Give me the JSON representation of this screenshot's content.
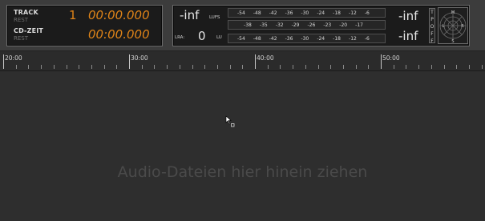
{
  "counter_panel": {
    "track_label": "TRACK",
    "track_sub": "REST",
    "track_number": "1",
    "track_time": "00:00.000",
    "cd_label": "CD-ZEIT",
    "cd_sub": "REST",
    "cd_time": "00:00.000"
  },
  "loudness_panel": {
    "integrated_value": "-inf",
    "lufs_label": "LUFS",
    "lra_label": "LRA:",
    "lra_value": "0",
    "lu_label": "LU",
    "scale_top": [
      "-54",
      "-48",
      "-42",
      "-36",
      "-30",
      "-24",
      "-18",
      "-12",
      "-6"
    ],
    "scale_middle": [
      "-38",
      "-35",
      "-32",
      "-29",
      "-26",
      "-23",
      "-20",
      "-17"
    ],
    "scale_bottom": [
      "-54",
      "-48",
      "-42",
      "-36",
      "-30",
      "-24",
      "-18",
      "-12",
      "-6"
    ],
    "peak_top_value": "-inf",
    "peak_bottom_value": "-inf",
    "tp_off_letters": [
      "T",
      "P",
      "O",
      "F",
      "F"
    ],
    "radar_labels": {
      "top": "M",
      "left": "L",
      "right": "R",
      "bottom": "S"
    }
  },
  "ruler": {
    "labels": [
      "20:00",
      "30:00",
      "40:00",
      "50:00"
    ]
  },
  "dropzone": {
    "text": "Audio-Dateien hier hinein ziehen"
  },
  "colors": {
    "accent_orange": "#e08418",
    "background": "#2e2e2e",
    "panel": "#1b1b1b"
  }
}
